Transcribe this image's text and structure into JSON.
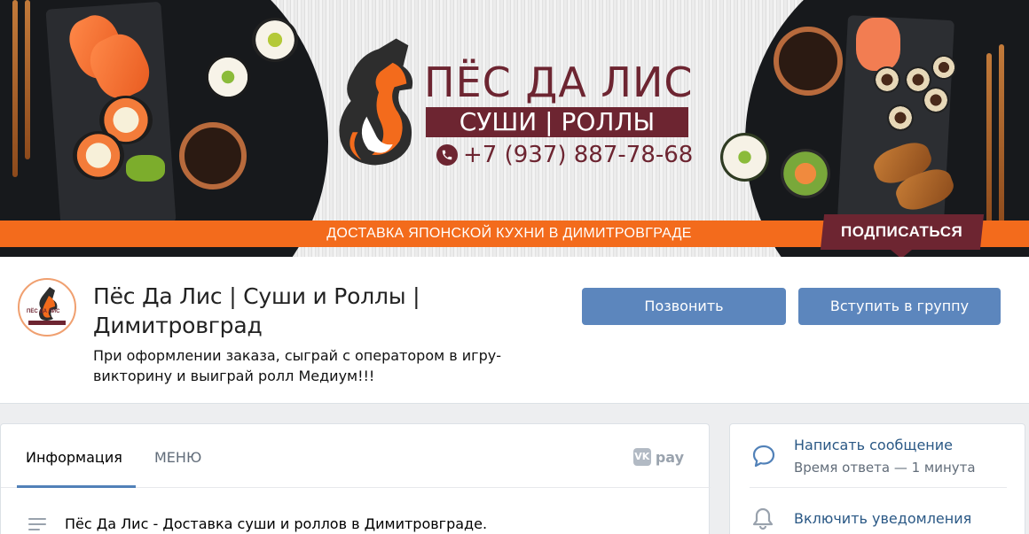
{
  "cover": {
    "brand_title": "ПЁС ДА ЛИС",
    "brand_subtitle": "СУШИ | РОЛЛЫ",
    "brand_phone": "+7 (937) 887-78-68",
    "band_text": "ДОСТАВКА ЯПОНСКОЙ КУХНИ В ДИМИТРОВГРАДЕ",
    "subscribe_label": "ПОДПИСАТЬСЯ",
    "colors": {
      "brand": "#6d2531",
      "orange": "#f36b1c"
    }
  },
  "header": {
    "avatar_text": "ПЁС ДА ЛИС",
    "group_name": "Пёс Да Лис | Суши и Роллы | Димитровград",
    "status": "При оформлении заказа, сыграй с оператором в игру-викторину и выиграй ролл Медиум!!!",
    "call_button": "Позвонить",
    "join_button": "Вступить в группу"
  },
  "info": {
    "tabs": [
      {
        "label": "Информация",
        "active": true
      },
      {
        "label": "МЕНЮ",
        "active": false
      }
    ],
    "vkpay_label": "pay",
    "description": "Пёс Да Лис - Доставка суши и роллов в Димитровграде."
  },
  "side": {
    "message_link": "Написать сообщение",
    "response_time": "Время ответа — 1 минута",
    "notifications": "Включить уведомления"
  },
  "icons": [
    "fox-logo-icon",
    "phone-icon",
    "vk-pay-icon",
    "text-lines-icon",
    "message-bubble-icon",
    "bell-icon"
  ]
}
